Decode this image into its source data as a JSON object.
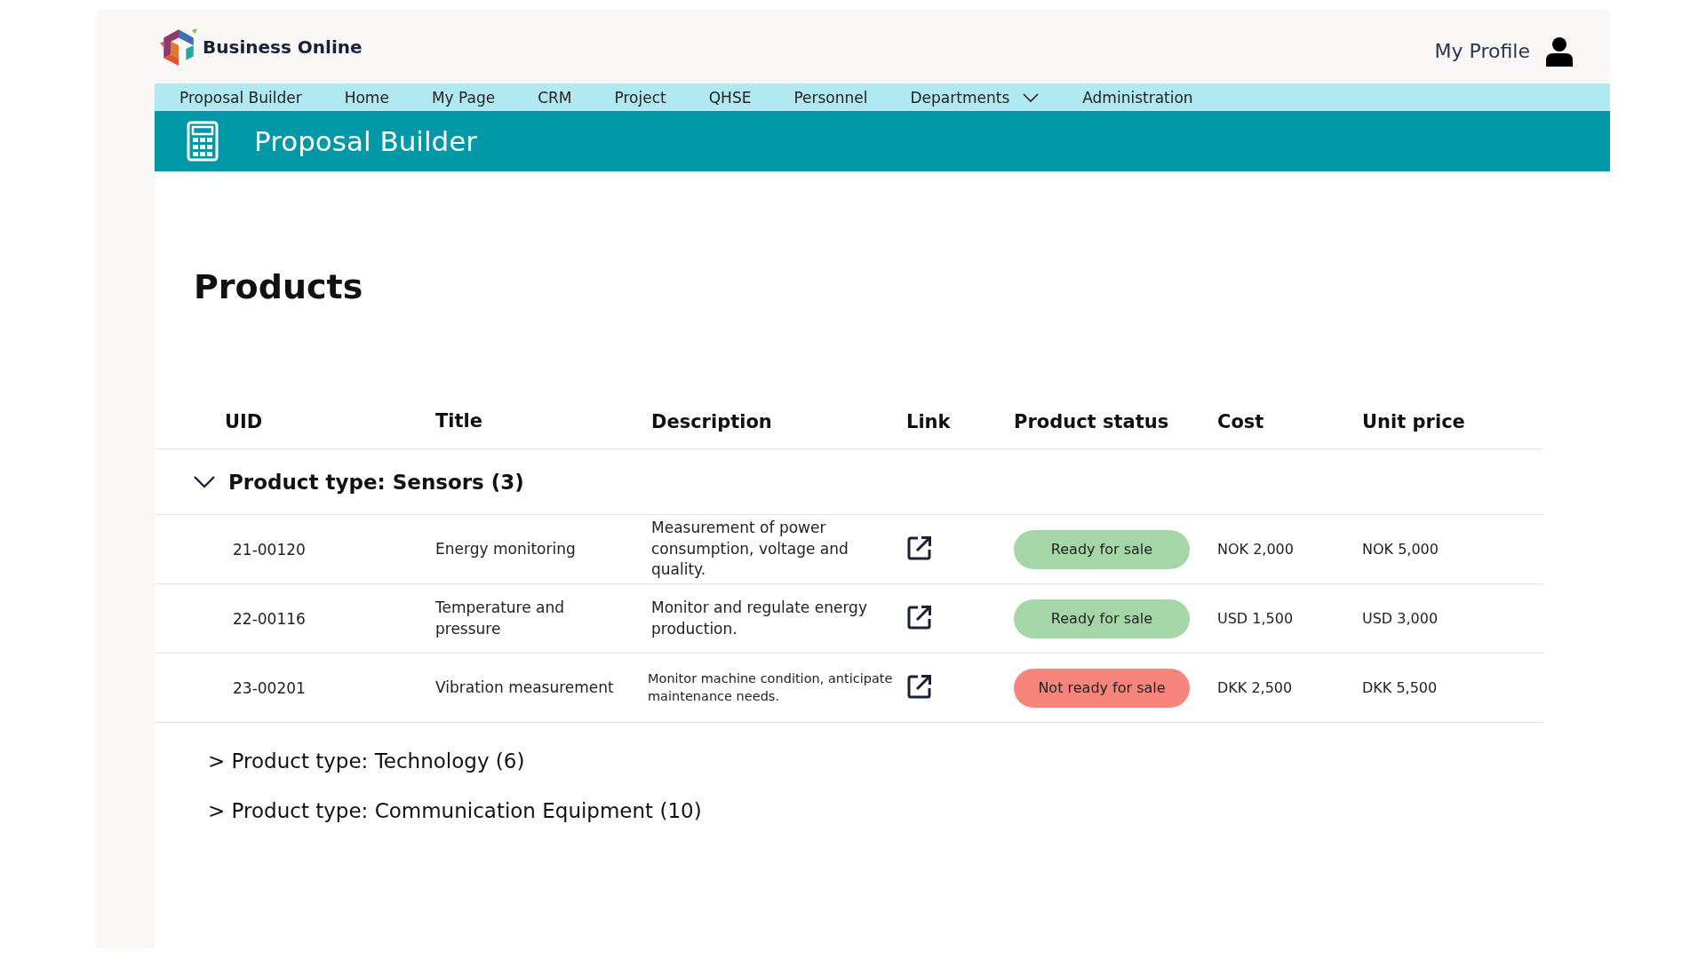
{
  "header": {
    "brand": "Business Online",
    "profile": "My Profile"
  },
  "nav": [
    {
      "label": "Proposal Builder",
      "dropdown": false
    },
    {
      "label": "Home",
      "dropdown": false
    },
    {
      "label": "My Page",
      "dropdown": false
    },
    {
      "label": "CRM",
      "dropdown": false
    },
    {
      "label": "Project",
      "dropdown": false
    },
    {
      "label": "QHSE",
      "dropdown": false
    },
    {
      "label": "Personnel",
      "dropdown": false
    },
    {
      "label": "Departments",
      "dropdown": true
    },
    {
      "label": "Administration",
      "dropdown": false
    }
  ],
  "banner": {
    "title": "Proposal Builder"
  },
  "page_title": "Products",
  "table": {
    "columns": [
      "UID",
      "Title",
      "Description",
      "Link",
      "Product status",
      "Cost",
      "Unit price"
    ],
    "groups": [
      {
        "label": "Product type: Sensors (3)",
        "expanded": true,
        "rows": [
          {
            "uid": "21-00120",
            "title": "Energy monitoring",
            "description": "Measurement of power consumption, voltage and quality.",
            "small_text": false,
            "status": {
              "label": "Ready for sale",
              "color": "#a5d6a7"
            },
            "cost": "NOK 2,000",
            "unit_price": "NOK 5,000"
          },
          {
            "uid": "22-00116",
            "title": "Temperature and pressure",
            "description": "Monitor and regulate energy production.",
            "small_text": false,
            "status": {
              "label": "Ready for sale",
              "color": "#a5d6a7"
            },
            "cost": "USD 1,500",
            "unit_price": "USD 3,000"
          },
          {
            "uid": "23-00201",
            "title": "Vibration measurement",
            "description": "Monitor machine condition, anticipate maintenance needs.",
            "small_text": true,
            "status": {
              "label": "Not ready for sale",
              "color": "#f7857b"
            },
            "cost": "DKK 2,500",
            "unit_price": "DKK 5,500"
          }
        ]
      },
      {
        "label": "> Product type: Technology (6)",
        "expanded": false
      },
      {
        "label": "> Product type: Communication Equipment (10)",
        "expanded": false
      }
    ]
  }
}
